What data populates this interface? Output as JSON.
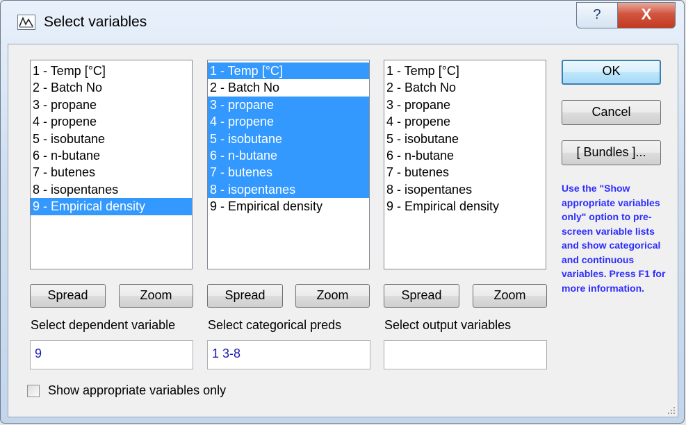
{
  "window": {
    "title": "Select variables",
    "help_glyph": "?",
    "close_glyph": "X"
  },
  "lists": [
    {
      "items": [
        "1 - Temp [°C]",
        "2 - Batch No",
        "3 - propane",
        "4 - propene",
        "5 - isobutane",
        "6 - n-butane",
        "7 - butenes",
        "8 - isopentanes",
        "9 - Empirical density"
      ],
      "selected": [
        9
      ],
      "label": "Select dependent variable",
      "value": "9"
    },
    {
      "items": [
        "1 - Temp [°C]",
        "2 - Batch No",
        "3 - propane",
        "4 - propene",
        "5 - isobutane",
        "6 - n-butane",
        "7 - butenes",
        "8 - isopentanes",
        "9 - Empirical density"
      ],
      "selected": [
        1,
        3,
        4,
        5,
        6,
        7,
        8
      ],
      "label": "Select categorical preds",
      "value": "1 3-8"
    },
    {
      "items": [
        "1 - Temp [°C]",
        "2 - Batch No",
        "3 - propane",
        "4 - propene",
        "5 - isobutane",
        "6 - n-butane",
        "7 - butenes",
        "8 - isopentanes",
        "9 - Empirical density"
      ],
      "selected": [],
      "label": "Select output variables",
      "value": ""
    }
  ],
  "buttons": {
    "spread": "Spread",
    "zoom": "Zoom",
    "ok": "OK",
    "cancel": "Cancel",
    "bundles": "[ Bundles ]..."
  },
  "hint_text": "Use the \"Show appropriate variables only\" option to pre-screen variable lists and show categorical and continuous variables. Press F1 for more information.",
  "checkbox": {
    "label": "Show appropriate variables only",
    "checked": false
  },
  "colors": {
    "selection": "#3399ff",
    "hint": "#2c2cff",
    "input_text": "#1a1ab0"
  }
}
